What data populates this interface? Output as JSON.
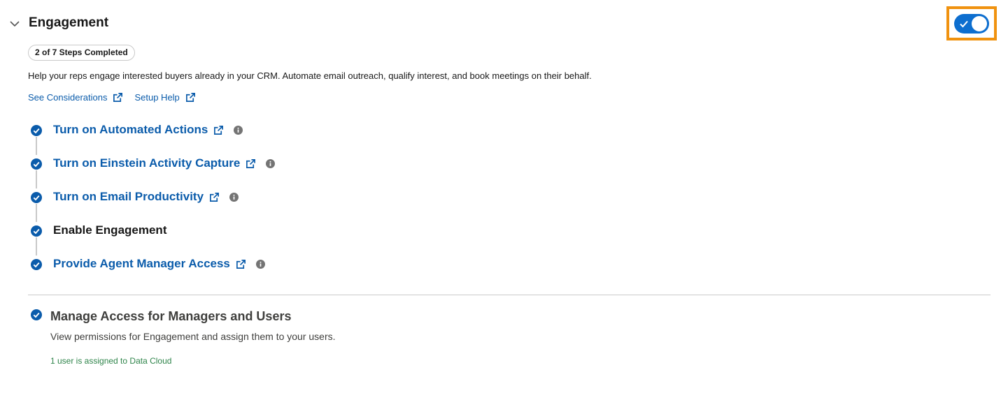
{
  "section": {
    "title": "Engagement",
    "progress_badge": "2 of 7 Steps Completed",
    "description": "Help your reps engage interested buyers already in your CRM. Automate email outreach, qualify interest, and book meetings on their behalf.",
    "toggle_on": true
  },
  "links": {
    "considerations": "See Considerations",
    "setup_help": "Setup Help"
  },
  "steps": [
    {
      "label": "Turn on Automated Actions",
      "completed": true,
      "is_link": true,
      "has_info": true
    },
    {
      "label": "Turn on Einstein Activity Capture",
      "completed": true,
      "is_link": true,
      "has_info": true
    },
    {
      "label": "Turn on Email Productivity",
      "completed": true,
      "is_link": true,
      "has_info": true
    },
    {
      "label": "Enable Engagement",
      "completed": true,
      "is_link": false,
      "has_info": false
    },
    {
      "label": "Provide Agent Manager Access",
      "completed": true,
      "is_link": true,
      "has_info": true
    }
  ],
  "manage": {
    "title": "Manage Access for Managers and Users",
    "description": "View permissions for Engagement and assign them to your users.",
    "status": "1 user is assigned to Data Cloud"
  },
  "colors": {
    "accent": "#0b5cab",
    "toggle": "#0d6ecf",
    "highlight": "#f0920f",
    "success_text": "#2e844a"
  }
}
